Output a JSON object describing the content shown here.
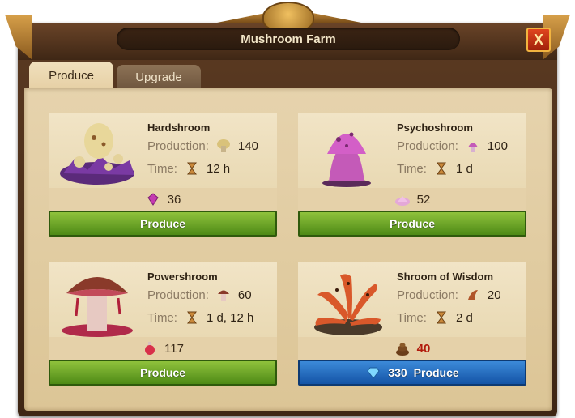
{
  "window": {
    "title": "Mushroom Farm",
    "close_label": "X"
  },
  "tabs": [
    {
      "label": "Produce",
      "active": true
    },
    {
      "label": "Upgrade",
      "active": false
    }
  ],
  "labels": {
    "production": "Production:",
    "time": "Time:"
  },
  "cards": [
    {
      "name": "Hardshroom",
      "production": "140",
      "time": "12 h",
      "cost": "36",
      "cost_icon": "gem-icon",
      "button": "Produce",
      "button_style": "green"
    },
    {
      "name": "Psychoshroom",
      "production": "100",
      "time": "1 d",
      "cost": "52",
      "cost_icon": "crystal-pile-icon",
      "button": "Produce",
      "button_style": "green"
    },
    {
      "name": "Powershroom",
      "production": "60",
      "time": "1 d, 12 h",
      "cost": "117",
      "cost_icon": "potion-icon",
      "button": "Produce",
      "button_style": "green"
    },
    {
      "name": "Shroom of Wisdom",
      "production": "20",
      "time": "2 d",
      "cost": "40",
      "cost_icon": "dung-icon",
      "cost_insufficient": true,
      "button": "Produce",
      "button_diamonds": "330",
      "button_style": "blue"
    }
  ],
  "colors": {
    "green_button": "#6aa82a",
    "blue_button": "#2a72c2",
    "insufficient": "#b21b0c"
  }
}
